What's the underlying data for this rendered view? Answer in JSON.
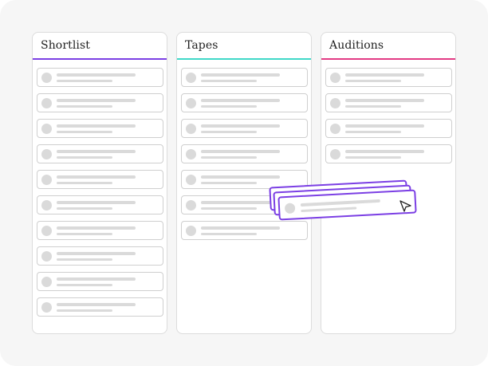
{
  "board": {
    "columns": [
      {
        "id": "shortlist",
        "title": "Shortlist",
        "accent": "#7b3fe4",
        "card_count": 10
      },
      {
        "id": "tapes",
        "title": "Tapes",
        "accent": "#3fd8c8",
        "card_count": 7
      },
      {
        "id": "auditions",
        "title": "Auditions",
        "accent": "#e23a84",
        "card_count": 4
      }
    ],
    "dragging": {
      "stack_count": 3,
      "accent": "#7b3fe4"
    }
  }
}
